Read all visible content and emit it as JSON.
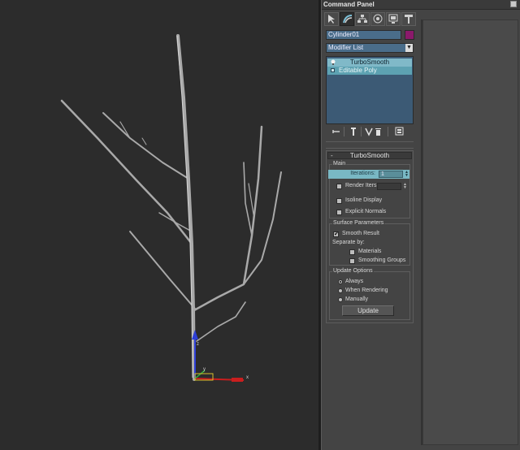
{
  "panel": {
    "title": "Command Panel"
  },
  "tabs": [
    {
      "name": "create-tab",
      "icon": "cursor-icon"
    },
    {
      "name": "modify-tab",
      "icon": "bend-icon",
      "active": true
    },
    {
      "name": "hierarchy-tab",
      "icon": "hierarchy-icon"
    },
    {
      "name": "motion-tab",
      "icon": "motion-icon"
    },
    {
      "name": "display-tab",
      "icon": "display-icon"
    },
    {
      "name": "utilities-tab",
      "icon": "hammer-icon"
    }
  ],
  "object": {
    "name": "Cylinder01",
    "color": "#8b1a6b"
  },
  "modifier_list": {
    "label": "Modifier List"
  },
  "stack": {
    "items": [
      {
        "label": "TurboSmooth",
        "selected": true
      },
      {
        "label": "Editable Poly",
        "selected": false
      }
    ]
  },
  "turbosmooth": {
    "title": "TurboSmooth",
    "main": {
      "title": "Main",
      "iterations_label": "Iterations:",
      "iterations_value": "1",
      "render_iters_label": "Render Iters:",
      "render_iters_value": "",
      "isoline_label": "Isoline Display",
      "explicit_normals_label": "Explicit Normals"
    },
    "surface": {
      "title": "Surface Parameters",
      "smooth_result_label": "Smooth Result",
      "smooth_result_checked": true,
      "separate_by_label": "Separate by:",
      "materials_label": "Materials",
      "smoothing_groups_label": "Smoothing Groups"
    },
    "update": {
      "title": "Update Options",
      "always_label": "Always",
      "when_rendering_label": "When Rendering",
      "manually_label": "Manually",
      "update_button_label": "Update"
    }
  },
  "gizmo": {
    "x_label": "x",
    "y_label": "y",
    "z_label": "z"
  },
  "colors": {
    "viewport_bg": "#2c2c2c",
    "panel_bg": "#444444",
    "field_blue": "#4a6d8a",
    "highlight_cyan": "#79b8c4",
    "branch": "#b9b9b9"
  }
}
